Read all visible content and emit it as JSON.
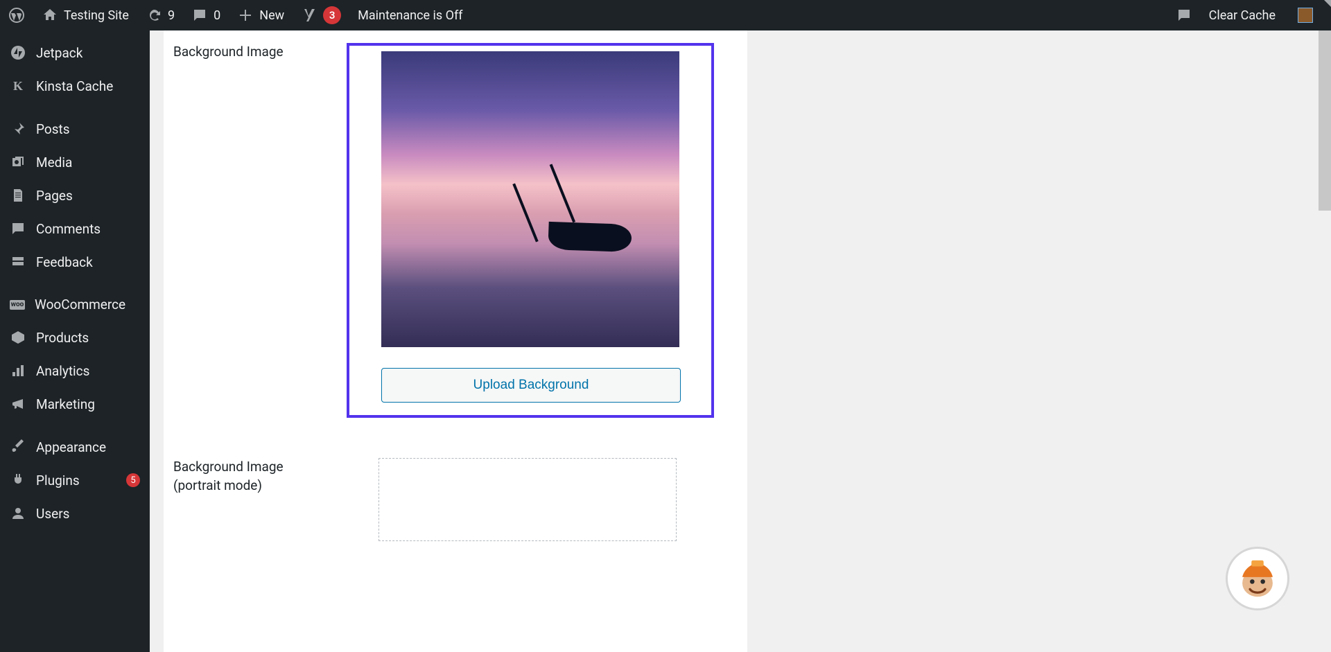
{
  "adminbar": {
    "site_name": "Testing Site",
    "updates_count": "9",
    "comments_count": "0",
    "new_label": "New",
    "yoast_count": "3",
    "maintenance_label": "Maintenance is Off",
    "clear_cache": "Clear Cache"
  },
  "sidebar": {
    "items": [
      {
        "label": "Jetpack"
      },
      {
        "label": "Kinsta Cache"
      },
      {
        "label": "Posts"
      },
      {
        "label": "Media"
      },
      {
        "label": "Pages"
      },
      {
        "label": "Comments"
      },
      {
        "label": "Feedback"
      },
      {
        "label": "WooCommerce"
      },
      {
        "label": "Products"
      },
      {
        "label": "Analytics"
      },
      {
        "label": "Marketing"
      },
      {
        "label": "Appearance"
      },
      {
        "label": "Plugins",
        "badge": "5"
      },
      {
        "label": "Users"
      }
    ]
  },
  "main": {
    "bg_image_label": "Background Image",
    "upload_button": "Upload Background",
    "bg_portrait_label": "Background Image (portrait mode)"
  }
}
